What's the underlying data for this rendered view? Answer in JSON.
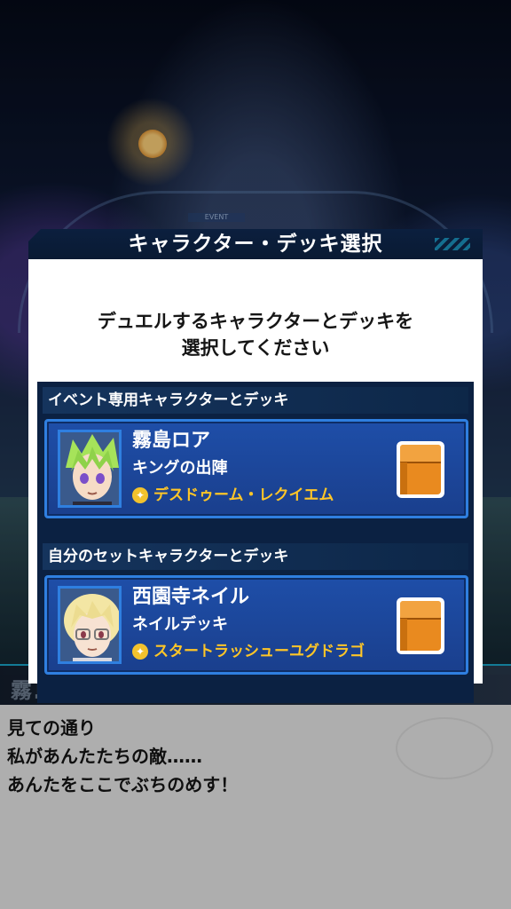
{
  "scene": {
    "event_tag": "EVENT"
  },
  "dialog": {
    "title": "キャラクター・デッキ選択",
    "prompt_line1": "デュエルするキャラクターとデッキを",
    "prompt_line2": "選択してください",
    "sections": [
      {
        "header": "イベント専用キャラクターとデッキ",
        "character_name": "霧島ロア",
        "deck_name": "キングの出陣",
        "ace_card": "デスドゥーム・レクイエム"
      },
      {
        "header": "自分のセットキャラクターとデッキ",
        "character_name": "西園寺ネイル",
        "deck_name": "ネイルデッキ",
        "ace_card": "スタートラッシューユグドラゴ"
      }
    ]
  },
  "message": {
    "speaker": "霧島ロミア",
    "line1": "見ての通り",
    "line2": "私があんたたちの敵……",
    "line3": "あんたをここでぶちのめす！"
  },
  "colors": {
    "card_bg": "#1e4ea8",
    "card_border": "#2f7fe0",
    "ace_text": "#ffc627",
    "deck_box": "#e98a1f",
    "panel_bg": "#0b2142"
  }
}
